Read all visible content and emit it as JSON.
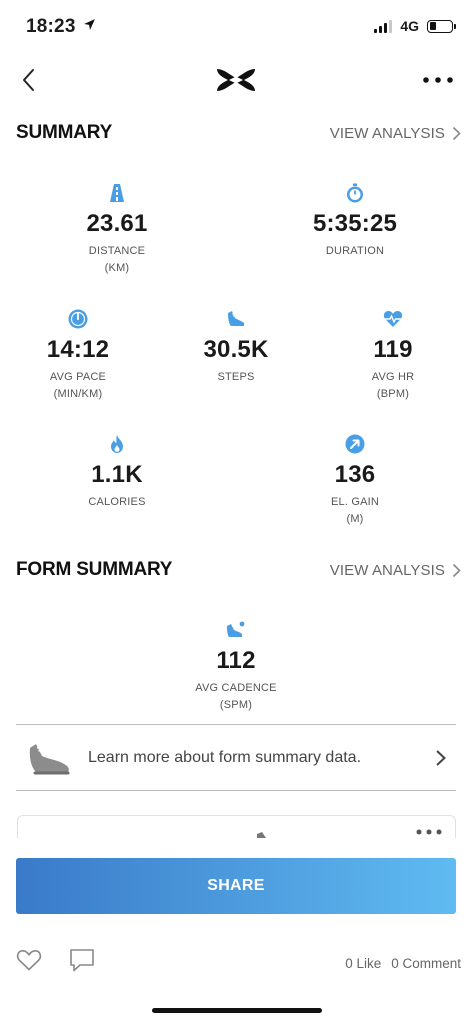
{
  "status_bar": {
    "time": "18:23",
    "network": "4G"
  },
  "colors": {
    "accent": "#4a9fe4",
    "share_start": "#3a7ac9",
    "share_end": "#5fbbf1"
  },
  "summary": {
    "title": "SUMMARY",
    "link": "VIEW ANALYSIS",
    "stats": [
      {
        "icon": "road-icon",
        "value": "23.61",
        "label": "DISTANCE",
        "unit": "(KM)"
      },
      {
        "icon": "stopwatch-icon",
        "value": "5:35:25",
        "label": "DURATION",
        "unit": ""
      },
      {
        "icon": "pace-gauge-icon",
        "value": "14:12",
        "label": "AVG PACE",
        "unit": "(MIN/KM)"
      },
      {
        "icon": "shoe-icon",
        "value": "30.5K",
        "label": "STEPS",
        "unit": ""
      },
      {
        "icon": "heart-rate-icon",
        "value": "119",
        "label": "AVG HR",
        "unit": "(BPM)"
      },
      {
        "icon": "flame-icon",
        "value": "1.1K",
        "label": "CALORIES",
        "unit": ""
      },
      {
        "icon": "elevation-icon",
        "value": "136",
        "label": "EL. GAIN",
        "unit": "(M)"
      }
    ]
  },
  "form_summary": {
    "title": "FORM SUMMARY",
    "link": "VIEW ANALYSIS",
    "cadence": {
      "icon": "cadence-shoe-icon",
      "value": "112",
      "label": "AVG CADENCE",
      "unit": "(SPM)"
    }
  },
  "learn_more": {
    "text": "Learn more about form summary data."
  },
  "share": {
    "label": "SHARE"
  },
  "footer": {
    "likes": "0 Like",
    "comments": "0 Comment"
  }
}
